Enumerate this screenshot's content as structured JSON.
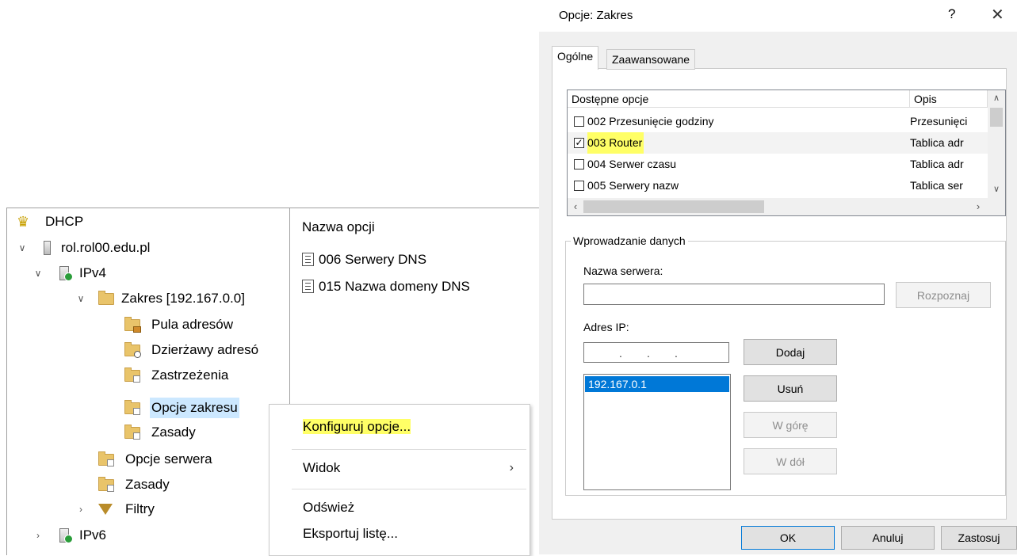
{
  "tree": {
    "root": "DHCP",
    "server": "rol.rol00.edu.pl",
    "ipv4": "IPv4",
    "scope": "Zakres [192.167.0.0]",
    "address_pool": "Pula adresów",
    "leases": "Dzierżawy adresó",
    "reservations": "Zastrzeżenia",
    "scope_options": "Opcje zakresu",
    "scope_policies": "Zasady",
    "server_options": "Opcje serwera",
    "policies": "Zasady",
    "filters": "Filtry",
    "ipv6": "IPv6"
  },
  "list": {
    "header": "Nazwa opcji",
    "rows": [
      "006 Serwery DNS",
      "015 Nazwa domeny DNS"
    ]
  },
  "context_menu": {
    "configure": "Konfiguruj opcje...",
    "view": "Widok",
    "refresh": "Odśwież",
    "export": "Eksportuj listę..."
  },
  "dialog": {
    "title": "Opcje: Zakres",
    "help": "?",
    "close": "✕",
    "tabs": [
      "Ogólne",
      "Zaawansowane"
    ],
    "options_list": {
      "col_available": "Dostępne opcje",
      "col_description": "Opis",
      "rows": [
        {
          "name": "002 Przesunięcie godziny",
          "desc": "Przesunięci",
          "checked": false
        },
        {
          "name": "003 Router",
          "desc": "Tablica adr",
          "checked": true
        },
        {
          "name": "004 Serwer czasu",
          "desc": "Tablica adr",
          "checked": false
        },
        {
          "name": "005 Serwery nazw",
          "desc": "Tablica ser",
          "checked": false
        }
      ]
    },
    "data_entry": {
      "group_label": "Wprowadzanie danych",
      "server_name_label": "Nazwa serwera:",
      "server_name_value": "",
      "resolve_button": "Rozpoznaj",
      "ip_label": "Adres IP:",
      "ip_value": ".        .        .",
      "add_button": "Dodaj",
      "remove_button": "Usuń",
      "up_button": "W górę",
      "down_button": "W dół",
      "ip_list": [
        "192.167.0.1"
      ]
    },
    "buttons": {
      "ok": "OK",
      "cancel": "Anuluj",
      "apply": "Zastosuj"
    }
  },
  "colors": {
    "highlight": "#ffff66",
    "selection": "#0078d7",
    "tree_selection": "#cce8ff"
  }
}
